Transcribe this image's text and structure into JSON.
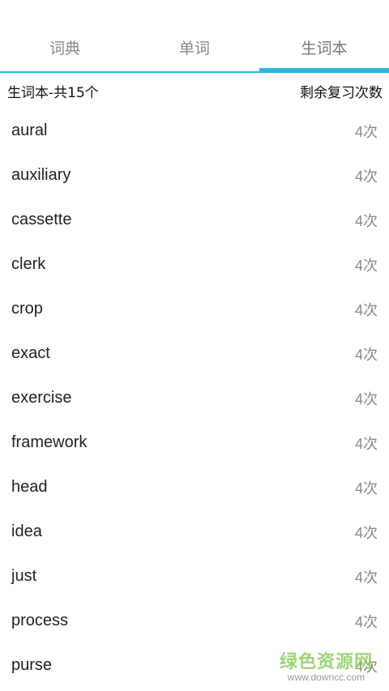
{
  "tabs": [
    {
      "label": "词典"
    },
    {
      "label": "单词"
    },
    {
      "label": "生词本"
    }
  ],
  "active_tab": "生词本",
  "accent_color": "#2fb3e3",
  "summary": {
    "left": "生词本-共15个",
    "right": "剩余复习次数"
  },
  "words": [
    {
      "word": "aural",
      "count": "4次"
    },
    {
      "word": "auxiliary",
      "count": "4次"
    },
    {
      "word": "cassette",
      "count": "4次"
    },
    {
      "word": "clerk",
      "count": "4次"
    },
    {
      "word": "crop",
      "count": "4次"
    },
    {
      "word": "exact",
      "count": "4次"
    },
    {
      "word": "exercise",
      "count": "4次"
    },
    {
      "word": "framework",
      "count": "4次"
    },
    {
      "word": "head",
      "count": "4次"
    },
    {
      "word": "idea",
      "count": "4次"
    },
    {
      "word": "just",
      "count": "4次"
    },
    {
      "word": "process",
      "count": "4次"
    },
    {
      "word": "purse",
      "count": "4次"
    }
  ],
  "watermark": {
    "text": "绿色资源网",
    "url": "www.downcc.com"
  }
}
